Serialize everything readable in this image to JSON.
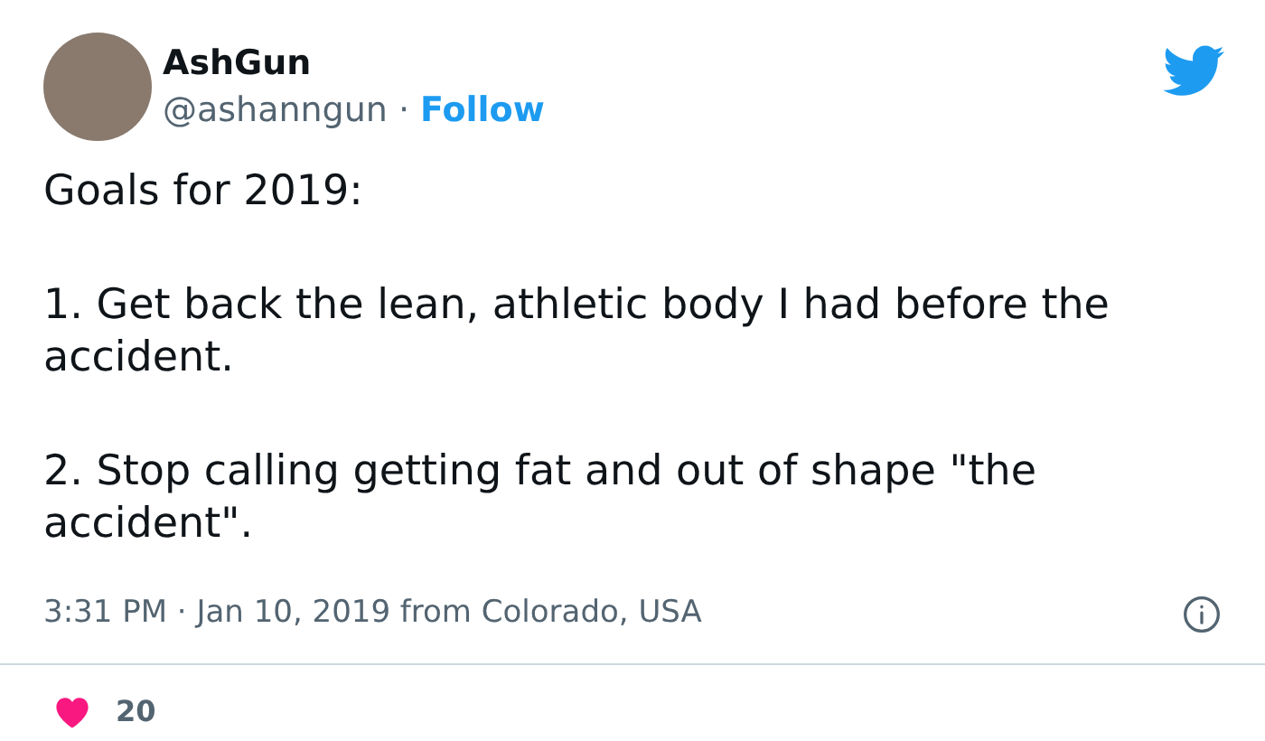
{
  "user": {
    "name": "AshGun",
    "handle": "@ashanngun",
    "separator": "·",
    "follow": "Follow"
  },
  "tweet": {
    "paragraphs": [
      "Goals for 2019:",
      "1. Get back the lean, athletic body I had before the accident.",
      "2. Stop calling getting fat and out of shape \"the accident\"."
    ]
  },
  "meta": {
    "timestamp": "3:31 PM · Jan 10, 2019 from Colorado, USA"
  },
  "likes": {
    "count": "20"
  }
}
